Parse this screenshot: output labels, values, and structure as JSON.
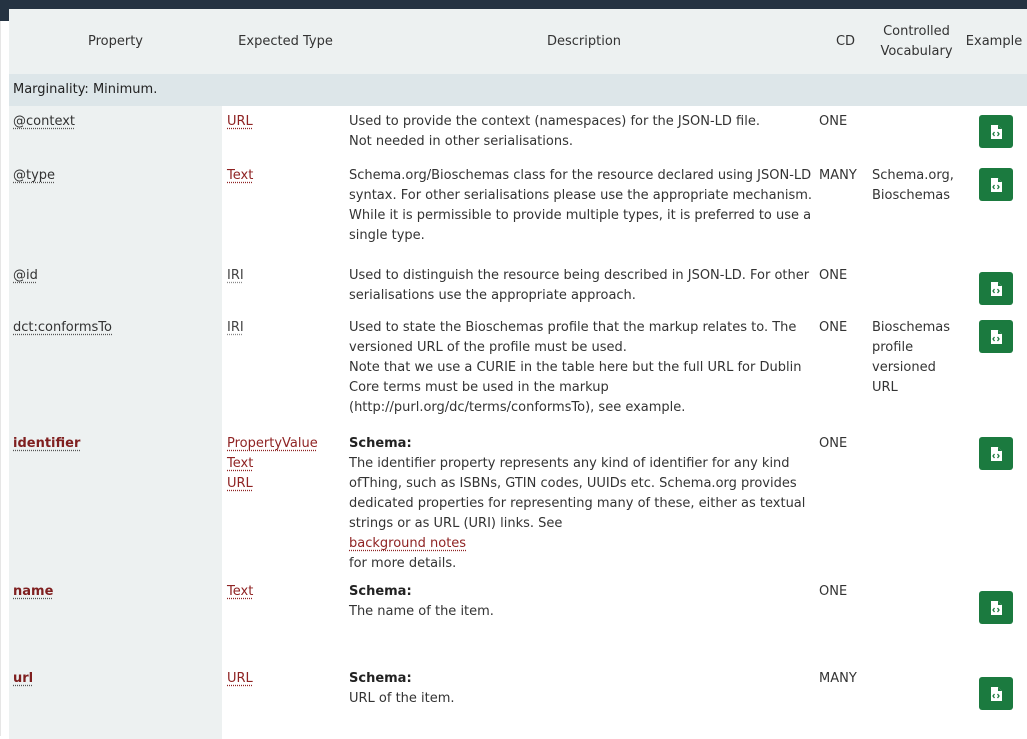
{
  "header": {
    "property": "Property",
    "expected_type": "Expected Type",
    "description": "Description",
    "cd": "CD",
    "controlled_vocabulary_line1": "Controlled",
    "controlled_vocabulary_line2": "Vocabulary",
    "example": "Example"
  },
  "section": {
    "label": "Marginality: Minimum."
  },
  "rows": [
    {
      "property": "@context",
      "types": [
        "URL"
      ],
      "desc_lines": [
        "Used to provide the context (namespaces) for the JSON-LD file.",
        "Not needed in other serialisations."
      ],
      "cd": "ONE",
      "cv_lines": []
    },
    {
      "property": "@type",
      "types": [
        "Text"
      ],
      "desc_lines": [
        "Schema.org/Bioschemas class for the resource declared using JSON-LD",
        "syntax. For other serialisations please use the appropriate mechanism.",
        "While it is permissible to provide multiple types, it is preferred to use a",
        "single type."
      ],
      "cd": "MANY",
      "cv_lines": [
        "Schema.org,",
        "Bioschemas"
      ]
    },
    {
      "property": "@id",
      "types": [
        "IRI"
      ],
      "desc_lines": [
        "Used to distinguish the resource being described in JSON-LD. For other",
        "serialisations use the appropriate approach."
      ],
      "cd": "ONE",
      "cv_lines": []
    },
    {
      "property": "dct:conformsTo",
      "types": [
        "IRI"
      ],
      "desc_lines": [
        "Used to state the Bioschemas profile that the markup relates to. The",
        "versioned URL of the profile must be used.",
        "Note that we use a CURIE in the table here but the full URL for Dublin",
        "Core terms must be used in the markup",
        "(http://purl.org/dc/terms/conformsTo), see example."
      ],
      "cd": "ONE",
      "cv_lines": [
        "Bioschemas",
        "profile",
        "versioned",
        "URL"
      ]
    },
    {
      "property": "identifier",
      "types": [
        "PropertyValue",
        "Text",
        "URL"
      ],
      "desc_heading": "Schema:",
      "desc_lines": [
        "The identifier property represents any kind of identifier for any kind",
        "ofThing, such as ISBNs, GTIN codes, UUIDs etc. Schema.org provides",
        "dedicated properties for representing many of these, either as textual"
      ],
      "desc_last_prefix": "strings or as URL (URI) links. See ",
      "desc_last_link": "background notes",
      "desc_last_suffix": " for more details.",
      "cd": "ONE",
      "cv_lines": []
    },
    {
      "property": "name",
      "types": [
        "Text"
      ],
      "desc_heading": "Schema:",
      "desc_lines": [
        "The name of the item."
      ],
      "cd": "ONE",
      "cv_lines": []
    },
    {
      "property": "url",
      "types": [
        "URL"
      ],
      "desc_heading": "Schema:",
      "desc_lines": [
        "URL of the item."
      ],
      "cd": "MANY",
      "cv_lines": []
    }
  ],
  "icons": {
    "example": "code-file-icon"
  },
  "colors": {
    "topbar": "#253342",
    "example_button": "#1b7a3f",
    "link": "#8f2323",
    "header_bg": "#edf1f1",
    "section_bg": "#dde6e9"
  }
}
